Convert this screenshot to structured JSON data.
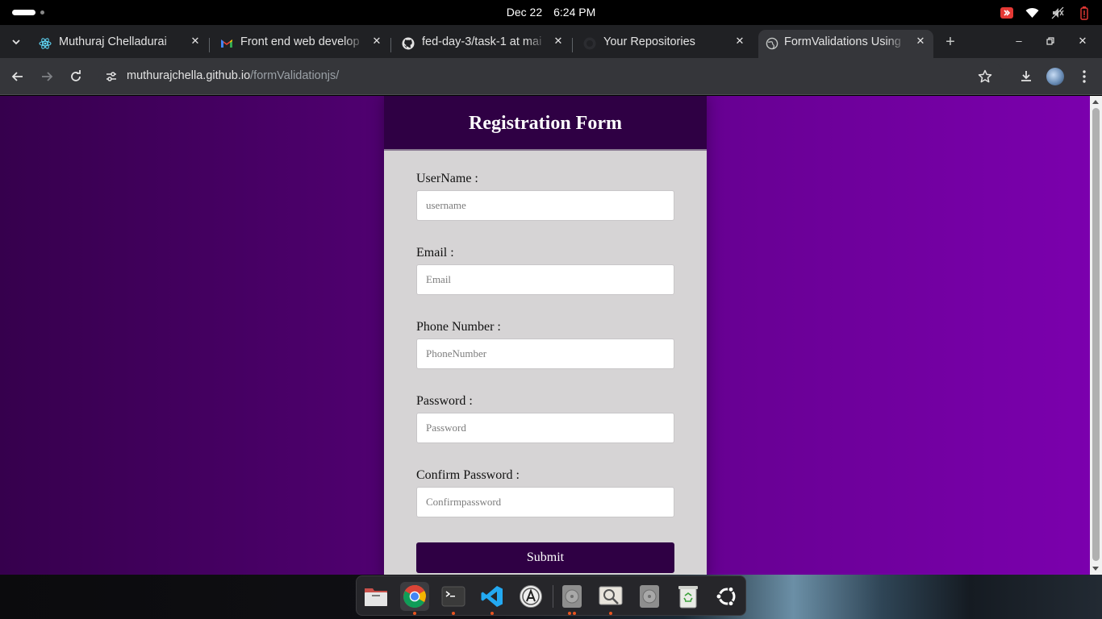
{
  "system": {
    "date": "Dec 22",
    "time": "6:24 PM",
    "tray_icons": [
      "app-indicator-icon",
      "wifi-icon",
      "volume-muted-icon",
      "battery-low-icon"
    ]
  },
  "browser": {
    "tabs": [
      {
        "title": "Muthuraj Chelladurai",
        "icon": "react-icon",
        "active": false
      },
      {
        "title": "Front end web develop",
        "icon": "gmail-icon",
        "active": false
      },
      {
        "title": "fed-day-3/task-1 at mai",
        "icon": "github-icon",
        "active": false
      },
      {
        "title": "Your Repositories",
        "icon": "github-icon",
        "active": false
      },
      {
        "title": "FormValidations Using",
        "icon": "globe-icon",
        "active": true
      }
    ],
    "url_host": "muthurajchella.github.io",
    "url_path": "/formValidationjs/"
  },
  "page": {
    "title": "Registration Form",
    "fields": [
      {
        "label": "UserName :",
        "placeholder": "username",
        "value": ""
      },
      {
        "label": "Email :",
        "placeholder": "Email",
        "value": ""
      },
      {
        "label": "Phone Number :",
        "placeholder": "PhoneNumber",
        "value": ""
      },
      {
        "label": "Password :",
        "placeholder": "Password",
        "value": ""
      },
      {
        "label": "Confirm Password :",
        "placeholder": "Confirmpassword",
        "value": ""
      }
    ],
    "submit_label": "Submit",
    "colors": {
      "header": "#2f0044",
      "card": "#d6d4d5",
      "bg_left": "#36004d",
      "bg_right": "#7b00ad"
    }
  },
  "dock": {
    "apps": [
      "files-icon",
      "chrome-icon",
      "terminal-icon",
      "vscode-icon",
      "app-center-icon",
      "disk-icon",
      "image-viewer-icon",
      "disk-icon",
      "trash-icon",
      "ubuntu-icon"
    ]
  }
}
